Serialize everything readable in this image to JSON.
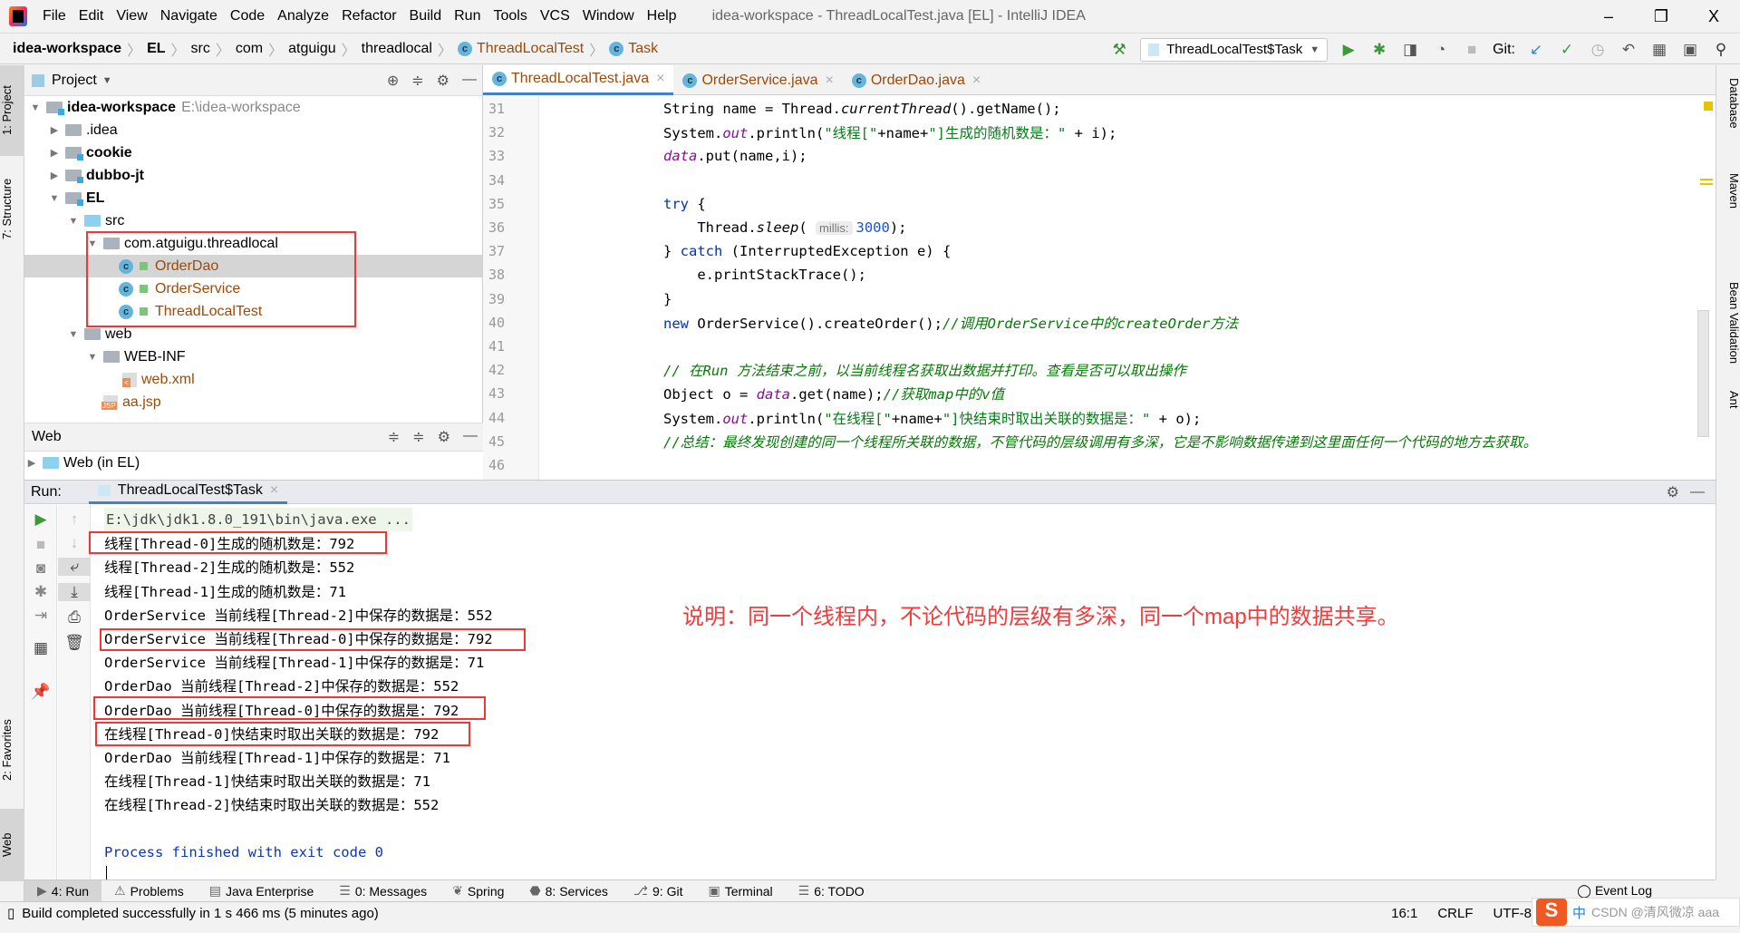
{
  "menu": {
    "items": [
      "File",
      "Edit",
      "View",
      "Navigate",
      "Code",
      "Analyze",
      "Refactor",
      "Build",
      "Run",
      "Tools",
      "VCS",
      "Window",
      "Help"
    ],
    "title": "idea-workspace - ThreadLocalTest.java [EL] - IntelliJ IDEA",
    "minimize": "–",
    "restore": "❐",
    "close": "X"
  },
  "breadcrumb": [
    "idea-workspace",
    "EL",
    "src",
    "com",
    "atguigu",
    "threadlocal",
    "ThreadLocalTest",
    "Task"
  ],
  "toolbar": {
    "run_config": "ThreadLocalTest$Task",
    "git_label": "Git:"
  },
  "left_strip": [
    "1: Project",
    "7: Structure",
    "2: Favorites",
    "Web"
  ],
  "right_strip": [
    "Database",
    "Maven",
    "Bean Validation",
    "Ant"
  ],
  "project": {
    "title": "Project",
    "tree": [
      {
        "label": "idea-workspace",
        "path": "E:\\idea-workspace",
        "level": 0,
        "expanded": true,
        "bold": true,
        "icon": "module-folder"
      },
      {
        "label": ".idea",
        "level": 1,
        "expanded": false,
        "icon": "folder"
      },
      {
        "label": "cookie",
        "level": 1,
        "expanded": false,
        "bold": true,
        "icon": "module-folder"
      },
      {
        "label": "dubbo-jt",
        "level": 1,
        "expanded": false,
        "bold": true,
        "icon": "module-folder"
      },
      {
        "label": "EL",
        "level": 1,
        "expanded": true,
        "bold": true,
        "icon": "module-folder"
      },
      {
        "label": "src",
        "level": 2,
        "expanded": true,
        "icon": "source-folder"
      },
      {
        "label": "com.atguigu.threadlocal",
        "level": 3,
        "expanded": true,
        "icon": "package"
      },
      {
        "label": "OrderDao",
        "level": 4,
        "icon": "class",
        "selected": true
      },
      {
        "label": "OrderService",
        "level": 4,
        "icon": "class"
      },
      {
        "label": "ThreadLocalTest",
        "level": 4,
        "icon": "class"
      },
      {
        "label": "web",
        "level": 2,
        "expanded": true,
        "icon": "web-folder"
      },
      {
        "label": "WEB-INF",
        "level": 3,
        "expanded": true,
        "icon": "folder"
      },
      {
        "label": "web.xml",
        "level": 4,
        "icon": "xml"
      },
      {
        "label": "aa.jsp",
        "level": 3,
        "icon": "jsp"
      }
    ]
  },
  "web_panel": {
    "title": "Web",
    "item": "Web (in EL)"
  },
  "editor": {
    "tabs": [
      {
        "label": "ThreadLocalTest.java",
        "active": true
      },
      {
        "label": "OrderService.java"
      },
      {
        "label": "OrderDao.java"
      }
    ],
    "lines": [
      {
        "n": "31",
        "t": [
          [
            "p",
            "String name = Thread."
          ],
          [
            "stat",
            "currentThread"
          ],
          [
            "p",
            "().getName();"
          ]
        ]
      },
      {
        "n": "32",
        "t": [
          [
            "p",
            "System."
          ],
          [
            "fld",
            "out"
          ],
          [
            "p",
            ".println("
          ],
          [
            "str",
            "\"线程[\""
          ],
          [
            "p",
            "+name+"
          ],
          [
            "str",
            "\"]生成的随机数是：\""
          ],
          [
            "p",
            " + i);"
          ]
        ]
      },
      {
        "n": "33",
        "t": [
          [
            "fld",
            "data"
          ],
          [
            "p",
            ".put(name,i);"
          ]
        ]
      },
      {
        "n": "34",
        "t": []
      },
      {
        "n": "35",
        "t": [
          [
            "kw",
            "try"
          ],
          [
            "p",
            " {"
          ]
        ]
      },
      {
        "n": "36",
        "t": [
          [
            "p",
            "    Thread."
          ],
          [
            "stat",
            "sleep"
          ],
          [
            "p",
            "( "
          ],
          [
            "hint",
            "millis:"
          ],
          [
            "num",
            "3000"
          ],
          [
            "p",
            ");"
          ]
        ]
      },
      {
        "n": "37",
        "t": [
          [
            "p",
            "} "
          ],
          [
            "kw",
            "catch"
          ],
          [
            "p",
            " (InterruptedException e) {"
          ]
        ]
      },
      {
        "n": "38",
        "t": [
          [
            "p",
            "    e.printStackTrace();"
          ]
        ]
      },
      {
        "n": "39",
        "t": [
          [
            "p",
            "}"
          ]
        ]
      },
      {
        "n": "40",
        "t": [
          [
            "kw",
            "new"
          ],
          [
            "p",
            " OrderService().createOrder();"
          ],
          [
            "cmt",
            "//调用OrderService中的createOrder方法"
          ]
        ]
      },
      {
        "n": "41",
        "t": []
      },
      {
        "n": "42",
        "t": [
          [
            "cmt",
            "// 在Run 方法结束之前，以当前线程名获取出数据并打印。查看是否可以取出操作"
          ]
        ]
      },
      {
        "n": "43",
        "t": [
          [
            "p",
            "Object o = "
          ],
          [
            "fld",
            "data"
          ],
          [
            "p",
            ".get(name);"
          ],
          [
            "cmt",
            "//获取map中的v值"
          ]
        ]
      },
      {
        "n": "44",
        "t": [
          [
            "p",
            "System."
          ],
          [
            "fld",
            "out"
          ],
          [
            "p",
            ".println("
          ],
          [
            "str",
            "\"在线程[\""
          ],
          [
            "p",
            "+name+"
          ],
          [
            "str",
            "\"]快结束时取出关联的数据是：\""
          ],
          [
            "p",
            " + o);"
          ]
        ]
      },
      {
        "n": "45",
        "t": [
          [
            "cmt",
            "//总结：最终发现创建的同一个线程所关联的数据，不管代码的层级调用有多深，它是不影响数据传递到这里面任何一个代码的地方去获取。"
          ]
        ]
      },
      {
        "n": "46",
        "t": []
      }
    ]
  },
  "run": {
    "label": "Run:",
    "tab": "ThreadLocalTest$Task",
    "console": [
      "E:\\jdk\\jdk1.8.0_191\\bin\\java.exe ...",
      "线程[Thread-0]生成的随机数是：792",
      "线程[Thread-2]生成的随机数是：552",
      "线程[Thread-1]生成的随机数是：71",
      "OrderService 当前线程[Thread-2]中保存的数据是：552",
      "OrderService 当前线程[Thread-0]中保存的数据是：792",
      "OrderService 当前线程[Thread-1]中保存的数据是：71",
      "OrderDao 当前线程[Thread-2]中保存的数据是：552",
      "OrderDao 当前线程[Thread-0]中保存的数据是：792",
      "在线程[Thread-0]快结束时取出关联的数据是：792",
      "OrderDao 当前线程[Thread-1]中保存的数据是：71",
      "在线程[Thread-1]快结束时取出关联的数据是：71",
      "在线程[Thread-2]快结束时取出关联的数据是：552",
      "",
      "Process finished with exit code 0"
    ]
  },
  "annotation": "说明：同一个线程内，不论代码的层级有多深，同一个map中的数据共享。",
  "bottom_tabs": [
    "4: Run",
    "Problems",
    "Java Enterprise",
    "0: Messages",
    "Spring",
    "8: Services",
    "9: Git",
    "Terminal",
    "6: TODO"
  ],
  "event_log": "Event Log",
  "status": {
    "message": "Build completed successfully in 1 s 466 ms (5 minutes ago)",
    "position": "16:1",
    "line_sep": "CRLF",
    "encoding": "UTF-8"
  },
  "watermark": "CSDN @清风微凉 aaa",
  "ime": {
    "logo": "S",
    "mode": "中"
  },
  "colors": {
    "accent": "#4083c9",
    "highlight_box": "#f23636",
    "note": "#f23b3b"
  }
}
